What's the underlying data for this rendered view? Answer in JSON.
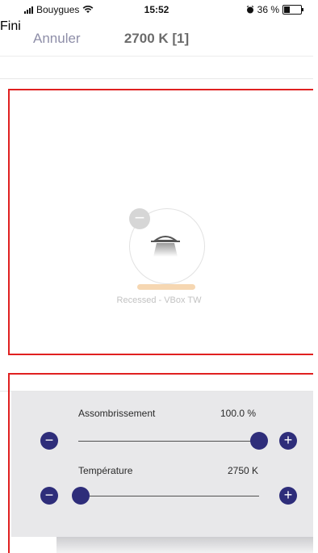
{
  "status_bar": {
    "carrier": "Bouygues",
    "time": "15:52",
    "battery_text": "36 %",
    "battery_level": 0.36
  },
  "nav": {
    "cancel_label": "Annuler",
    "title": "2700 K [1]",
    "done_label": "Fini"
  },
  "scene": {
    "device_label": "Recessed - VBox TW",
    "remove_symbol": "−",
    "device_icon": "recessed-light-icon"
  },
  "controls": {
    "dimming": {
      "label": "Assombrissement",
      "value_text": "100.0 %",
      "value": 100,
      "min": 0,
      "max": 100
    },
    "temperature": {
      "label": "Température",
      "value_text": "2750 K",
      "value": 2750,
      "min": 2700,
      "max": 6500
    },
    "minus_symbol": "−",
    "plus_symbol": "+"
  },
  "colors": {
    "accent": "#2e2d7a",
    "nav_link": "#7d7daa",
    "highlight_box": "#e02020"
  }
}
